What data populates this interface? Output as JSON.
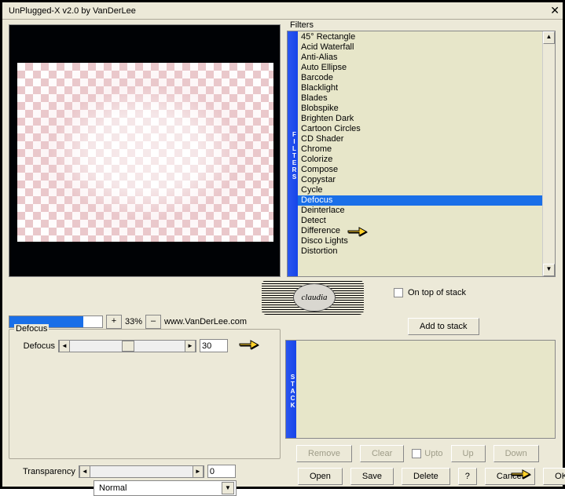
{
  "window": {
    "title": "UnPlugged-X v2.0 by VanDerLee"
  },
  "filters": {
    "group_label": "Filters",
    "tab_label": "FILTERS",
    "items": [
      "45° Rectangle",
      "Acid Waterfall",
      "Anti-Alias",
      "Auto Ellipse",
      "Barcode",
      "Blacklight",
      "Blades",
      "Blobspike",
      "Brighten Dark",
      "Cartoon Circles",
      "CD Shader",
      "Chrome",
      "Colorize",
      "Compose",
      "Copystar",
      "Cycle",
      "Defocus",
      "Deinterlace",
      "Detect",
      "Difference",
      "Disco Lights",
      "Distortion"
    ],
    "selected_index": 16,
    "on_top_label": "On top of stack"
  },
  "logo_text": "claudia",
  "zoom": {
    "percent_fill": 80,
    "plus": "+",
    "minus": "–",
    "value": "33%",
    "site": "www.VanDerLee.com"
  },
  "defocus": {
    "group_label": "Defocus",
    "param_label": "Defocus",
    "value": "30"
  },
  "addstack": {
    "label": "Add to stack"
  },
  "stack": {
    "tab_label": "STACK"
  },
  "stack_buttons": {
    "remove": "Remove",
    "clear": "Clear",
    "upto": "Upto",
    "up": "Up",
    "down": "Down"
  },
  "transparency": {
    "label": "Transparency",
    "value": "0"
  },
  "blend": {
    "value": "Normal"
  },
  "bottom": {
    "open": "Open",
    "save": "Save",
    "delete": "Delete",
    "help": "?",
    "cancel": "Cancel",
    "ok": "OK"
  }
}
